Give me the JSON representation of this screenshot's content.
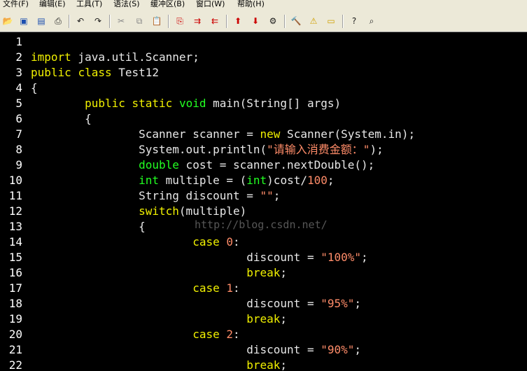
{
  "menu": [
    "文件(F)",
    "编辑(E)",
    "工具(T)",
    "语法(S)",
    "缓冲区(B)",
    "窗口(W)",
    "帮助(H)"
  ],
  "watermark": "http://blog.csdn.net/",
  "lines": [
    [],
    [
      [
        "import",
        "kw"
      ],
      [
        " java.util.Scanner;",
        "n"
      ]
    ],
    [
      [
        "public",
        "kw"
      ],
      [
        " ",
        "n"
      ],
      [
        "class",
        "kw"
      ],
      [
        " Test12",
        "n"
      ]
    ],
    [
      [
        "{",
        "n"
      ]
    ],
    [
      [
        "        ",
        "n"
      ],
      [
        "public",
        "kw"
      ],
      [
        " ",
        "n"
      ],
      [
        "static",
        "kw"
      ],
      [
        " ",
        "n"
      ],
      [
        "void",
        "ty"
      ],
      [
        " main(String[] args)",
        "n"
      ]
    ],
    [
      [
        "        {",
        "n"
      ]
    ],
    [
      [
        "                Scanner scanner = ",
        "n"
      ],
      [
        "new",
        "kw"
      ],
      [
        " Scanner(System.in);",
        "n"
      ]
    ],
    [
      [
        "                System.out.println(",
        "n"
      ],
      [
        "\"请输入消费金额：\"",
        "st"
      ],
      [
        ");",
        "n"
      ]
    ],
    [
      [
        "                ",
        "n"
      ],
      [
        "double",
        "ty"
      ],
      [
        " cost = scanner.nextDouble();",
        "n"
      ]
    ],
    [
      [
        "                ",
        "n"
      ],
      [
        "int",
        "ty"
      ],
      [
        " multiple = (",
        "n"
      ],
      [
        "int",
        "ty"
      ],
      [
        ")cost/",
        "n"
      ],
      [
        "100",
        "nu"
      ],
      [
        ";",
        "n"
      ]
    ],
    [
      [
        "                String discount = ",
        "n"
      ],
      [
        "\"\"",
        "st"
      ],
      [
        ";",
        "n"
      ]
    ],
    [
      [
        "                ",
        "n"
      ],
      [
        "switch",
        "kw"
      ],
      [
        "(multiple)",
        "n"
      ]
    ],
    [
      [
        "                {",
        "n"
      ]
    ],
    [
      [
        "                        ",
        "n"
      ],
      [
        "case",
        "kw"
      ],
      [
        " ",
        "n"
      ],
      [
        "0",
        "nu"
      ],
      [
        ":",
        "n"
      ]
    ],
    [
      [
        "                                discount = ",
        "n"
      ],
      [
        "\"100%\"",
        "st"
      ],
      [
        ";",
        "n"
      ]
    ],
    [
      [
        "                                ",
        "n"
      ],
      [
        "break",
        "kw"
      ],
      [
        ";",
        "n"
      ]
    ],
    [
      [
        "                        ",
        "n"
      ],
      [
        "case",
        "kw"
      ],
      [
        " ",
        "n"
      ],
      [
        "1",
        "nu"
      ],
      [
        ":",
        "n"
      ]
    ],
    [
      [
        "                                discount = ",
        "n"
      ],
      [
        "\"95%\"",
        "st"
      ],
      [
        ";",
        "n"
      ]
    ],
    [
      [
        "                                ",
        "n"
      ],
      [
        "break",
        "kw"
      ],
      [
        ";",
        "n"
      ]
    ],
    [
      [
        "                        ",
        "n"
      ],
      [
        "case",
        "kw"
      ],
      [
        " ",
        "n"
      ],
      [
        "2",
        "nu"
      ],
      [
        ":",
        "n"
      ]
    ],
    [
      [
        "                                discount = ",
        "n"
      ],
      [
        "\"90%\"",
        "st"
      ],
      [
        ";",
        "n"
      ]
    ],
    [
      [
        "                                ",
        "n"
      ],
      [
        "break",
        "kw"
      ],
      [
        ";",
        "n"
      ]
    ]
  ],
  "line_numbers": [
    "1",
    "2",
    "3",
    "4",
    "5",
    "6",
    "7",
    "8",
    "9",
    "10",
    "11",
    "12",
    "13",
    "14",
    "15",
    "16",
    "17",
    "18",
    "19",
    "20",
    "21",
    "22"
  ]
}
